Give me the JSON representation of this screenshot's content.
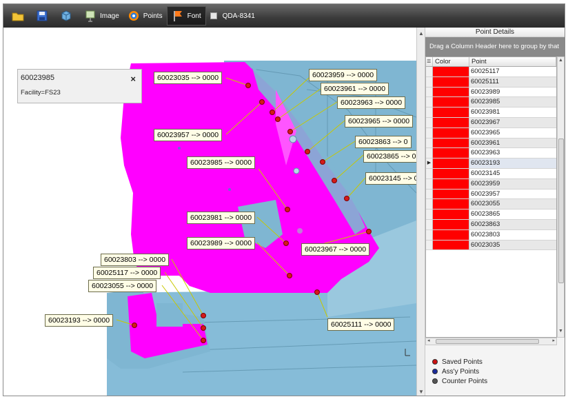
{
  "toolbar": {
    "image_label": "Image",
    "points_label": "Points",
    "font_label": "Font",
    "qda_label": "QDA-8341"
  },
  "info_box": {
    "point_id": "60023985",
    "facility": "Facility=FS23",
    "close_glyph": "×"
  },
  "callouts": [
    {
      "id": "c1",
      "text": "60023035 --> 0000"
    },
    {
      "id": "c2",
      "text": "60023959 --> 0000"
    },
    {
      "id": "c3",
      "text": "60023961 --> 0000"
    },
    {
      "id": "c4",
      "text": "60023963 --> 0000"
    },
    {
      "id": "c5",
      "text": "60023965 --> 0000"
    },
    {
      "id": "c6",
      "text": "60023957 --> 0000"
    },
    {
      "id": "c7",
      "text": "60023863 --> 0"
    },
    {
      "id": "c8",
      "text": "60023865 --> 0"
    },
    {
      "id": "c9",
      "text": "60023985 --> 0000"
    },
    {
      "id": "c10",
      "text": "60023145 --> 0"
    },
    {
      "id": "c11",
      "text": "60023981 --> 0000"
    },
    {
      "id": "c12",
      "text": "60023989 --> 0000"
    },
    {
      "id": "c13",
      "text": "60023967 --> 0000"
    },
    {
      "id": "c14",
      "text": "60023803 --> 0000"
    },
    {
      "id": "c15",
      "text": "60025117 --> 0000"
    },
    {
      "id": "c16",
      "text": "60023055 --> 0000"
    },
    {
      "id": "c17",
      "text": "60023193 --> 0000"
    },
    {
      "id": "c18",
      "text": "60025111 --> 0000"
    }
  ],
  "panel": {
    "title": "Point Details",
    "group_hint": "Drag a Column Header here to group by that",
    "col_color": "Color",
    "col_point": "Point",
    "rows": [
      "60025117",
      "60025111",
      "60023989",
      "60023985",
      "60023981",
      "60023967",
      "60023965",
      "60023961",
      "60023963",
      "60023193",
      "60023145",
      "60023959",
      "60023957",
      "60023055",
      "60023865",
      "60023863",
      "60023803",
      "60023035"
    ],
    "current_row_glyph": "▶",
    "row_color": "#ff0000"
  },
  "legend": {
    "saved": "Saved Points",
    "assy": "Ass'y Points",
    "counter": "Counter Points",
    "saved_color": "#cc1111",
    "assy_color": "#1a2a9a",
    "counter_color": "#555555"
  },
  "colors": {
    "part_magenta": "#ff00ff",
    "body_blue": "#7fb6d2",
    "point_red": "#cc1111"
  }
}
